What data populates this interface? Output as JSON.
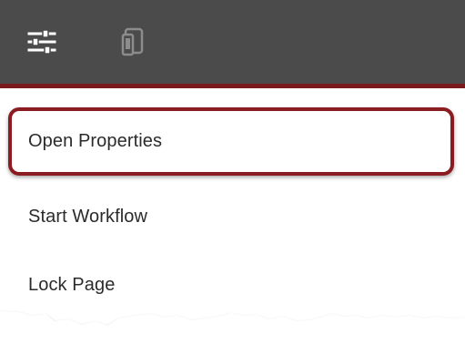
{
  "toolbar": {
    "background_color": "#4b4b4b",
    "accent_color": "#7a1a1d",
    "icons": [
      "page-properties-icon",
      "emulator-icon"
    ]
  },
  "menu": {
    "items": [
      {
        "label": "Open Properties",
        "highlighted": true
      },
      {
        "label": "Start Workflow",
        "highlighted": false
      },
      {
        "label": "Lock Page",
        "highlighted": false
      }
    ]
  },
  "highlight": {
    "color": "#8a1c22"
  }
}
